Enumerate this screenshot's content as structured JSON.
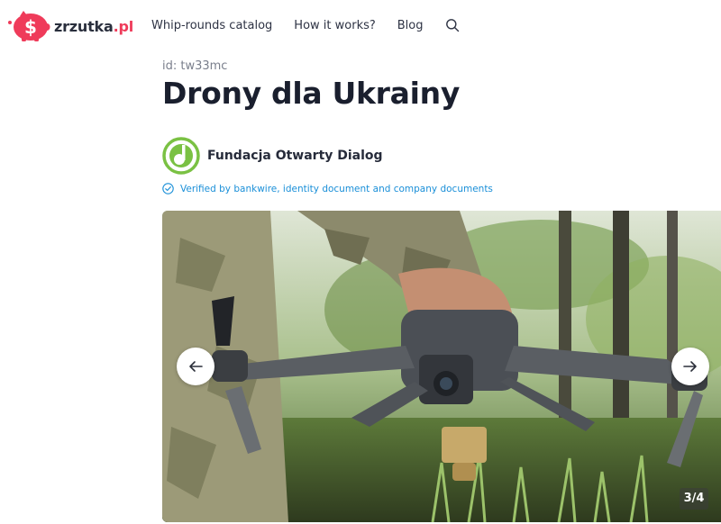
{
  "header": {
    "logo": {
      "brand": "zrzutka",
      "tld": ".pl"
    },
    "nav": [
      {
        "label": "Whip-rounds catalog"
      },
      {
        "label": "How it works?"
      },
      {
        "label": "Blog"
      }
    ],
    "search_icon": "search-icon"
  },
  "campaign": {
    "id_text": "id: tw33mc",
    "title": "Drony dla Ukrainy",
    "organizer": {
      "name": "Fundacja Otwarty Dialog",
      "logo_color": "#7ac143"
    },
    "verified_text": "Verified by bankwire, identity document and company documents"
  },
  "gallery": {
    "counter": "3/4",
    "prev_icon": "arrow-left-icon",
    "next_icon": "arrow-right-icon"
  },
  "colors": {
    "brand": "#ef3b5a",
    "link_blue": "#1a8fd8",
    "title": "#1a1f2e"
  }
}
